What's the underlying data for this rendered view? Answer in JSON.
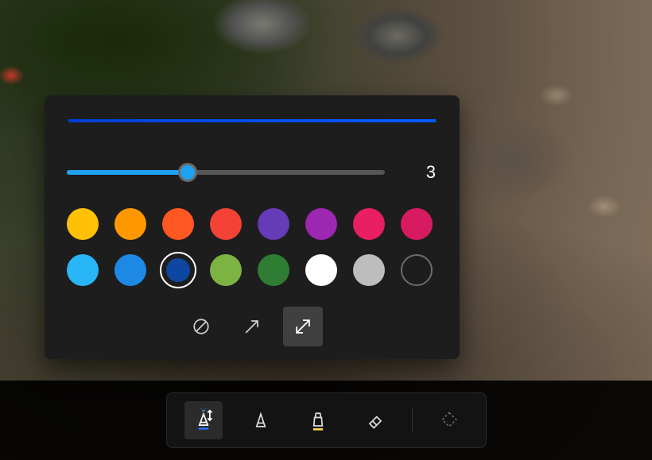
{
  "popup": {
    "preview_color": "#0047d6",
    "slider": {
      "value": "3",
      "min": 1,
      "max": 20,
      "percent": 38
    },
    "colors": {
      "row1": [
        "#ffc107",
        "#ff9800",
        "#ff5722",
        "#f44336",
        "#673ab7",
        "#9c27b0",
        "#e91e63",
        "#d81b60"
      ],
      "row2": [
        "#29b6f6",
        "#1e88e5",
        "#0d47a1",
        "#7cb342",
        "#2e7d32",
        "#ffffff",
        "#bdbdbd",
        "hollow"
      ],
      "selected_index": [
        1,
        2
      ]
    },
    "tips": [
      {
        "id": "none",
        "name": "tip-straight-icon",
        "active": false
      },
      {
        "id": "arrow",
        "name": "tip-arrow-icon",
        "active": false
      },
      {
        "id": "both",
        "name": "tip-doublearrow-icon",
        "active": true
      }
    ]
  },
  "toolbar": {
    "tools": [
      {
        "id": "pen",
        "name": "pen-tool",
        "active": true,
        "underline": "#2e6bff"
      },
      {
        "id": "pen-plain",
        "name": "pen-plain-tool",
        "active": false,
        "underline": null
      },
      {
        "id": "highlighter",
        "name": "highlighter-tool",
        "active": false,
        "underline": "#ffd54f"
      },
      {
        "id": "eraser",
        "name": "eraser-tool",
        "active": false,
        "underline": null
      },
      {
        "id": "shape",
        "name": "shape-tool",
        "active": false,
        "disabled": true
      }
    ]
  }
}
